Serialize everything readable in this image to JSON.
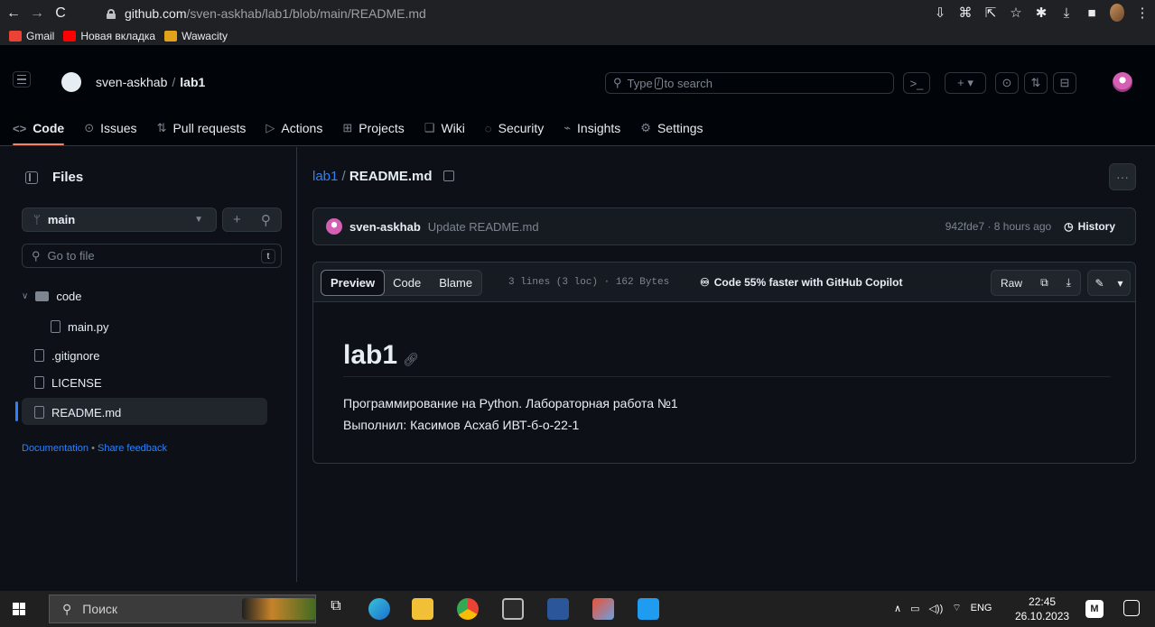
{
  "browser": {
    "url_host": "github.com",
    "url_path": "/sven-askhab/lab1/blob/main/README.md",
    "bookmarks": [
      {
        "label": "Gmail",
        "color": "#ea4335"
      },
      {
        "label": "Новая вкладка",
        "color": "#ff0000"
      },
      {
        "label": "Wawacity",
        "color": "#e3a21a"
      }
    ]
  },
  "header": {
    "owner": "sven-askhab",
    "separator": "/",
    "repo": "lab1",
    "search_prefix": "Type",
    "search_key": "/",
    "search_suffix": "to search"
  },
  "tabs": [
    {
      "label": "Code",
      "icon": "<>"
    },
    {
      "label": "Issues",
      "icon": "⊙"
    },
    {
      "label": "Pull requests",
      "icon": "⇅"
    },
    {
      "label": "Actions",
      "icon": "▷"
    },
    {
      "label": "Projects",
      "icon": "⊞"
    },
    {
      "label": "Wiki",
      "icon": "❑"
    },
    {
      "label": "Security",
      "icon": "◌"
    },
    {
      "label": "Insights",
      "icon": "⌁"
    },
    {
      "label": "Settings",
      "icon": "⚙"
    }
  ],
  "sidebar": {
    "title": "Files",
    "branch": "main",
    "goto_placeholder": "Go to file",
    "goto_key": "t",
    "tree": [
      "code",
      "main.py",
      ".gitignore",
      "LICENSE",
      "README.md"
    ],
    "footer_doc": "Documentation",
    "footer_dot": "•",
    "footer_feedback": "Share feedback"
  },
  "file": {
    "crumb_repo": "lab1",
    "crumb_sep": "/",
    "crumb_file": "README.md",
    "commit_author": "sven-askhab",
    "commit_message": "Update README.md",
    "commit_meta": "942fde7 · 8 hours ago",
    "history": "History",
    "tab_preview": "Preview",
    "tab_code": "Code",
    "tab_blame": "Blame",
    "meta": "3 lines (3 loc) · 162 Bytes",
    "copilot": "Code 55% faster with GitHub Copilot",
    "raw": "Raw"
  },
  "readme": {
    "heading": "lab1",
    "line1": "Программирование на Python. Лабораторная работа №1",
    "line2": "Выполнил: Касимов Асхаб ИВТ-б-о-22-1"
  },
  "taskbar": {
    "search_placeholder": "Поиск",
    "lang": "ENG",
    "time": "22:45",
    "date": "26.10.2023"
  }
}
